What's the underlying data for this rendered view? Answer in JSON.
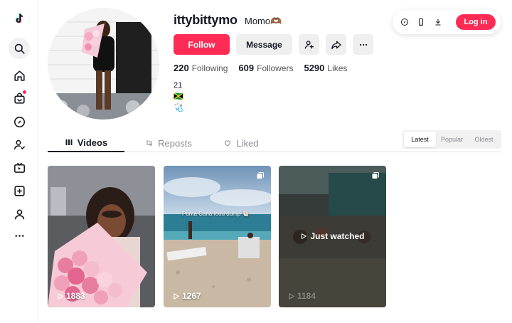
{
  "profile": {
    "username": "ittybittymo",
    "nickname": "Momo🫶🏾",
    "bio_lines": [
      "21",
      "🇯🇲",
      "🩺"
    ]
  },
  "actions": {
    "follow_label": "Follow",
    "message_label": "Message"
  },
  "stats": {
    "following_count": "220",
    "following_label": "Following",
    "followers_count": "609",
    "followers_label": "Followers",
    "likes_count": "5290",
    "likes_label": "Likes"
  },
  "topbar": {
    "login_label": "Log in"
  },
  "tabs": {
    "videos": "Videos",
    "reposts": "Reposts",
    "liked": "Liked"
  },
  "sort": {
    "options": [
      "Latest",
      "Popular",
      "Oldest"
    ],
    "selected": "Latest"
  },
  "videos": [
    {
      "views": "1883"
    },
    {
      "views": "1267",
      "caption": "Punta Cana food dump 🐚"
    },
    {
      "views": "1184",
      "status": "Just watched"
    }
  ],
  "colors": {
    "brand": "#fe2c55",
    "text": "#161823",
    "muted": "#8a8b91"
  }
}
